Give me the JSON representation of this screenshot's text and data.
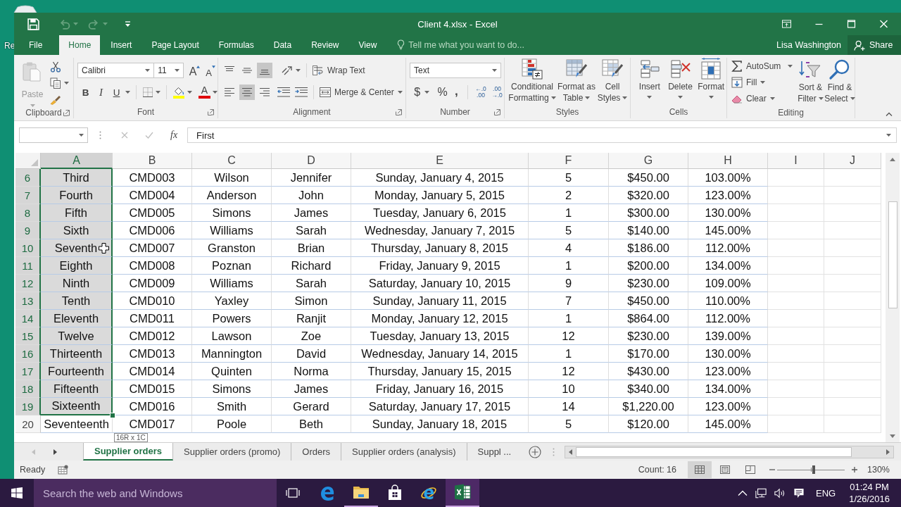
{
  "desktop": {
    "icon_label": "Re"
  },
  "window": {
    "title": "Client 4.xlsx - Excel",
    "quick_access": [
      {
        "kind": "save",
        "disabled": false
      },
      {
        "kind": "undo",
        "disabled": true
      },
      {
        "kind": "redo",
        "disabled": true
      }
    ]
  },
  "tabs": [
    {
      "label": "File",
      "selected": false
    },
    {
      "label": "Home",
      "selected": true
    },
    {
      "label": "Insert",
      "selected": false
    },
    {
      "label": "Page Layout",
      "selected": false
    },
    {
      "label": "Formulas",
      "selected": false
    },
    {
      "label": "Data",
      "selected": false
    },
    {
      "label": "Review",
      "selected": false
    },
    {
      "label": "View",
      "selected": false
    }
  ],
  "tell_me": {
    "placeholder": "Tell me what you want to do..."
  },
  "account": {
    "user": "Lisa Washington",
    "share": "Share"
  },
  "ribbon": {
    "clipboard": {
      "label": "Clipboard",
      "paste": {
        "label": "Paste",
        "disabled": true
      }
    },
    "font": {
      "label": "Font",
      "font_name": "Calibri",
      "font_size": "11",
      "grow": "A",
      "shrink": "A",
      "bold": "B",
      "italic": "I",
      "underline": "U",
      "font_color": "A"
    },
    "alignment": {
      "label": "Alignment",
      "vertical": [
        {
          "kind": "top",
          "on": false
        },
        {
          "kind": "middle",
          "on": false
        },
        {
          "kind": "bottom",
          "on": true
        }
      ],
      "horizontal": [
        {
          "kind": "left",
          "on": false
        },
        {
          "kind": "center",
          "on": true
        },
        {
          "kind": "right",
          "on": false
        }
      ],
      "wrap_text": "Wrap Text",
      "merge_center": "Merge & Center"
    },
    "number": {
      "label": "Number",
      "format": "Text",
      "currency": "$",
      "percent": "%",
      "comma": ",",
      "increase_decimal": [
        "←.0",
        ".00"
      ],
      "decrease_decimal": [
        ".00",
        "→.0"
      ]
    },
    "styles": {
      "label": "Styles",
      "buttons": [
        {
          "kind": "conditional",
          "lines": [
            "Conditional",
            "Formatting"
          ]
        },
        {
          "kind": "table",
          "lines": [
            "Format as",
            "Table"
          ]
        },
        {
          "kind": "cell",
          "lines": [
            "Cell",
            "Styles"
          ]
        }
      ]
    },
    "cells": {
      "label": "Cells",
      "buttons": [
        {
          "kind": "insert",
          "label": "Insert"
        },
        {
          "kind": "delete",
          "label": "Delete"
        },
        {
          "kind": "format",
          "label": "Format"
        }
      ]
    },
    "editing": {
      "label": "Editing",
      "autosum": "AutoSum",
      "fill": "Fill",
      "clear": "Clear",
      "buttons": [
        {
          "kind": "sort",
          "lines": [
            "Sort &",
            "Filter"
          ]
        },
        {
          "kind": "find",
          "lines": [
            "Find &",
            "Select"
          ]
        }
      ]
    }
  },
  "formula_bar": {
    "cancel": {
      "disabled": true
    },
    "enter": {
      "disabled": true
    },
    "function_label": "fx",
    "formula": "First"
  },
  "sheet": {
    "columns": [
      {
        "label": "A",
        "selected": true
      },
      {
        "label": "B",
        "selected": false
      },
      {
        "label": "C",
        "selected": false
      },
      {
        "label": "D",
        "selected": false
      },
      {
        "label": "E",
        "selected": false
      },
      {
        "label": "F",
        "selected": false
      },
      {
        "label": "G",
        "selected": false
      },
      {
        "label": "H",
        "selected": false
      },
      {
        "label": "I",
        "selected": false
      },
      {
        "label": "J",
        "selected": false
      }
    ],
    "rows": [
      {
        "header": "6",
        "selected": true,
        "cells": [
          "Third",
          "CMD003",
          "Wilson",
          "Jennifer",
          "Sunday, January 4, 2015",
          "5",
          "$450.00",
          "103.00%"
        ]
      },
      {
        "header": "7",
        "selected": true,
        "cells": [
          "Fourth",
          "CMD004",
          "Anderson",
          "John",
          "Monday, January 5, 2015",
          "2",
          "$320.00",
          "123.00%"
        ]
      },
      {
        "header": "8",
        "selected": true,
        "cells": [
          "Fifth",
          "CMD005",
          "Simons",
          "James",
          "Tuesday, January 6, 2015",
          "1",
          "$300.00",
          "130.00%"
        ]
      },
      {
        "header": "9",
        "selected": true,
        "cells": [
          "Sixth",
          "CMD006",
          "Williams",
          "Sarah",
          "Wednesday, January 7, 2015",
          "5",
          "$140.00",
          "145.00%"
        ]
      },
      {
        "header": "10",
        "selected": true,
        "cells": [
          "Seventh",
          "CMD007",
          "Granston",
          "Brian",
          "Thursday, January 8, 2015",
          "4",
          "$186.00",
          "112.00%"
        ]
      },
      {
        "header": "11",
        "selected": true,
        "cells": [
          "Eighth",
          "CMD008",
          "Poznan",
          "Richard",
          "Friday, January 9, 2015",
          "1",
          "$200.00",
          "134.00%"
        ]
      },
      {
        "header": "12",
        "selected": true,
        "cells": [
          "Ninth",
          "CMD009",
          "Williams",
          "Sarah",
          "Saturday, January 10, 2015",
          "9",
          "$230.00",
          "109.00%"
        ]
      },
      {
        "header": "13",
        "selected": true,
        "cells": [
          "Tenth",
          "CMD010",
          "Yaxley",
          "Simon",
          "Sunday, January 11, 2015",
          "7",
          "$450.00",
          "110.00%"
        ]
      },
      {
        "header": "14",
        "selected": true,
        "cells": [
          "Eleventh",
          "CMD011",
          "Powers",
          "Ranjit",
          "Monday, January 12, 2015",
          "1",
          "$864.00",
          "112.00%"
        ]
      },
      {
        "header": "15",
        "selected": true,
        "cells": [
          "Twelve",
          "CMD012",
          "Lawson",
          "Zoe",
          "Tuesday, January 13, 2015",
          "12",
          "$230.00",
          "139.00%"
        ]
      },
      {
        "header": "16",
        "selected": true,
        "cells": [
          "Thirteenth",
          "CMD013",
          "Mannington",
          "David",
          "Wednesday, January 14, 2015",
          "1",
          "$170.00",
          "130.00%"
        ]
      },
      {
        "header": "17",
        "selected": true,
        "cells": [
          "Fourteenth",
          "CMD014",
          "Quinten",
          "Norma",
          "Thursday, January 15, 2015",
          "12",
          "$430.00",
          "123.00%"
        ]
      },
      {
        "header": "18",
        "selected": true,
        "cells": [
          "Fifteenth",
          "CMD015",
          "Simons",
          "James",
          "Friday, January 16, 2015",
          "10",
          "$340.00",
          "134.00%"
        ]
      },
      {
        "header": "19",
        "selected": true,
        "cells": [
          "Sixteenth",
          "CMD016",
          "Smith",
          "Gerard",
          "Saturday, January 17, 2015",
          "14",
          "$1,220.00",
          "123.00%"
        ]
      },
      {
        "header": "20",
        "selected": false,
        "cells": [
          "Seventeenth",
          "CMD017",
          "Poole",
          "Beth",
          "Sunday, January 18, 2015",
          "5",
          "$120.00",
          "145.00%"
        ]
      }
    ],
    "selection_size": "16R x 1C"
  },
  "sheet_tabs": {
    "nav": [
      {
        "disabled": true
      },
      {
        "disabled": false
      }
    ],
    "tabs": [
      {
        "label": "Supplier orders",
        "selected": true
      },
      {
        "label": "Supplier orders (promo)",
        "selected": false
      },
      {
        "label": "Orders",
        "selected": false
      },
      {
        "label": "Supplier orders (analysis)",
        "selected": false
      },
      {
        "label": "Suppl ...",
        "selected": false
      }
    ]
  },
  "status_bar": {
    "mode": "Ready",
    "count": "Count: 16",
    "views": [
      {
        "kind": "normal",
        "selected": true
      },
      {
        "kind": "page_layout",
        "selected": false
      },
      {
        "kind": "page_break",
        "selected": false
      }
    ],
    "zoom": {
      "level": 0.54,
      "reading": "130%"
    }
  },
  "taskbar": {
    "search": {
      "placeholder": "Search the web and Windows"
    },
    "apps": [
      {
        "kind": "edge",
        "open": false,
        "selected": false
      },
      {
        "kind": "explorer",
        "open": true,
        "selected": false
      },
      {
        "kind": "store",
        "open": false,
        "selected": false
      },
      {
        "kind": "ie",
        "open": false,
        "selected": false
      },
      {
        "kind": "excel",
        "open": true,
        "selected": true
      }
    ],
    "language": "ENG",
    "time": "01:24 PM",
    "date": "1/26/2016"
  }
}
